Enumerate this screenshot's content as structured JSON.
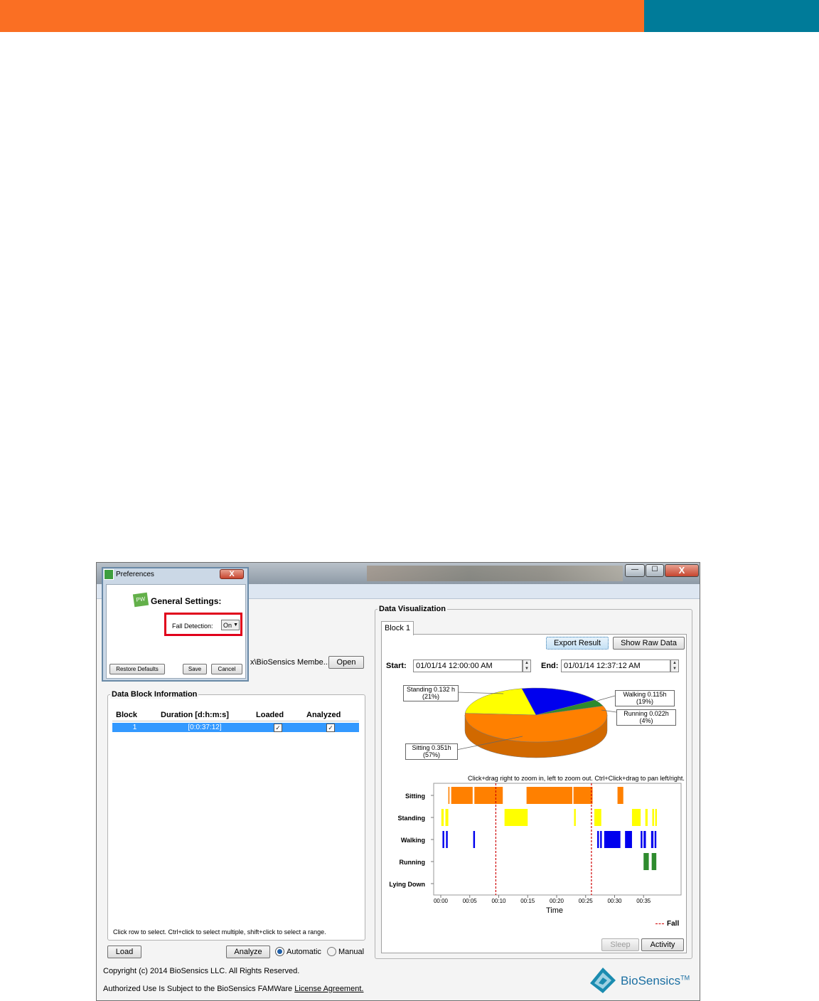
{
  "app": {
    "copyright": "Copyright (c) 2014 BioSensics LLC. All Rights Reserved.",
    "license_prefix": "Authorized Use Is Subject to the BioSensics FAMWare ",
    "license_link": "License Agreement.",
    "brand": "BioSensics",
    "brand_tm": "TM"
  },
  "window_controls": {
    "minimize": "—",
    "maximize": "☐",
    "close": "X"
  },
  "preferences": {
    "title": "Preferences",
    "close": "X",
    "logo_text": "PW",
    "heading": "General Settings:",
    "fall_detection_label": "Fall Detection:",
    "fall_detection_value": "On",
    "restore_defaults": "Restore Defaults",
    "save": "Save",
    "cancel": "Cancel"
  },
  "file": {
    "path": "x\\BioSensics Membe...",
    "open": "Open"
  },
  "data_block": {
    "legend": "Data Block Information",
    "columns": [
      "Block",
      "Duration [d:h:m:s]",
      "Loaded",
      "Analyzed"
    ],
    "rows": [
      {
        "block": "1",
        "duration": "[0:0:37:12]",
        "loaded": true,
        "analyzed": true
      }
    ],
    "hint": "Click row to select. Ctrl+click to select multiple, shift+click to select a range.",
    "load": "Load",
    "analyze": "Analyze",
    "mode_automatic": "Automatic",
    "mode_manual": "Manual",
    "mode_selected": "Automatic"
  },
  "visualization": {
    "legend": "Data Visualization",
    "tab": "Block 1",
    "export": "Export Result",
    "raw": "Show Raw Data",
    "start_label": "Start:",
    "start_value": "01/01/14 12:00:00 AM",
    "end_label": "End:",
    "end_value": "01/01/14 12:37:12 AM",
    "zoom_hint": "Click+drag right to zoom in, left to zoom out. Ctrl+Click+drag to pan left/right.",
    "sleep": "Sleep",
    "activity": "Activity"
  },
  "chart_data": [
    {
      "type": "pie",
      "slices": [
        {
          "label": "Sitting 0.351h",
          "pct": "(57%)",
          "value": 57,
          "color": "#ff8000"
        },
        {
          "label": "Standing 0.132 h",
          "pct": "(21%)",
          "value": 21,
          "color": "#ffff00"
        },
        {
          "label": "Walking 0.115h",
          "pct": "(19%)",
          "value": 19,
          "color": "#0000ee"
        },
        {
          "label": "Running 0.022h",
          "pct": "(4%)",
          "value": 4,
          "color": "#2e8b2e"
        }
      ]
    },
    {
      "type": "timeline",
      "xlabel": "Time",
      "xticks": [
        "00:00",
        "00:05",
        "00:10",
        "00:15",
        "00:20",
        "00:25",
        "00:30",
        "00:35"
      ],
      "xlim": [
        0,
        40
      ],
      "categories": [
        "Sitting",
        "Standing",
        "Walking",
        "Running",
        "Lying Down"
      ],
      "colors": {
        "Sitting": "#ff8000",
        "Standing": "#ffff00",
        "Walking": "#0000ee",
        "Running": "#2e8b2e"
      },
      "segments": {
        "Sitting": [
          [
            1.3,
            1.5
          ],
          [
            1.8,
            5.5
          ],
          [
            5.8,
            10.7
          ],
          [
            14.8,
            22.7
          ],
          [
            22.9,
            26.2
          ],
          [
            30.5,
            31.5
          ]
        ],
        "Standing": [
          [
            0.1,
            0.5
          ],
          [
            0.8,
            1.3
          ],
          [
            11.0,
            15.0
          ],
          [
            23.0,
            23.3
          ],
          [
            26.5,
            27.7
          ],
          [
            33.0,
            34.5
          ],
          [
            35.3,
            35.7
          ],
          [
            36.5,
            36.8
          ],
          [
            37.0,
            37.3
          ]
        ],
        "Walking": [
          [
            0.3,
            0.6
          ],
          [
            0.9,
            1.2
          ],
          [
            5.6,
            5.9
          ],
          [
            27.0,
            27.3
          ],
          [
            27.5,
            27.8
          ],
          [
            28.2,
            31.0
          ],
          [
            31.8,
            33.0
          ],
          [
            34.5,
            34.8
          ],
          [
            35.0,
            35.4
          ],
          [
            36.3,
            36.7
          ],
          [
            36.9,
            37.2
          ]
        ],
        "Running": [
          [
            35.0,
            35.9
          ],
          [
            36.4,
            37.2
          ]
        ]
      },
      "falls": [
        9.5,
        26.0
      ],
      "legend": "Fall"
    }
  ]
}
